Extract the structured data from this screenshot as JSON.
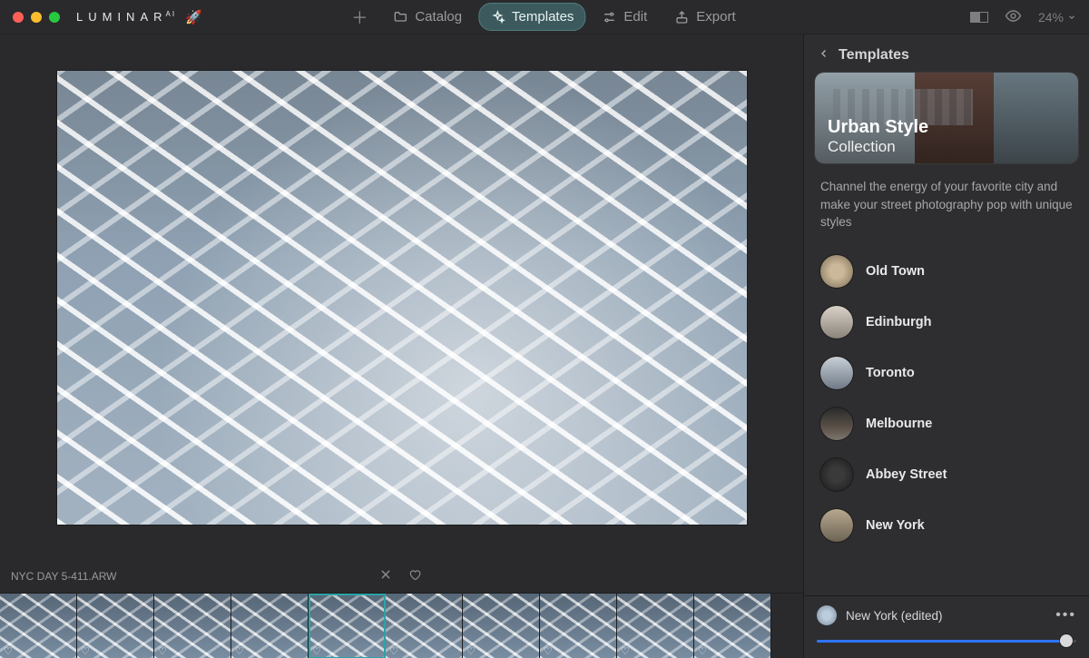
{
  "app": {
    "name": "LUMINAR",
    "suffix": "AI"
  },
  "toolbar": {
    "catalog": "Catalog",
    "templates": "Templates",
    "edit": "Edit",
    "export": "Export",
    "zoom": "24%"
  },
  "file": {
    "name": "NYC DAY 5-411.ARW"
  },
  "filmstrip": {
    "count": 10,
    "selectedIndex": 4
  },
  "panel": {
    "back_label": "Templates",
    "banner_title": "Urban Style",
    "banner_subtitle": "Collection",
    "description": "Channel the energy of your favorite city and make your street photography pop with unique styles",
    "templates": [
      {
        "label": "Old Town"
      },
      {
        "label": "Edinburgh"
      },
      {
        "label": "Toronto"
      },
      {
        "label": "Melbourne"
      },
      {
        "label": "Abbey Street"
      },
      {
        "label": "New York"
      }
    ],
    "current": {
      "label": "New York (edited)",
      "amount": 96
    }
  }
}
